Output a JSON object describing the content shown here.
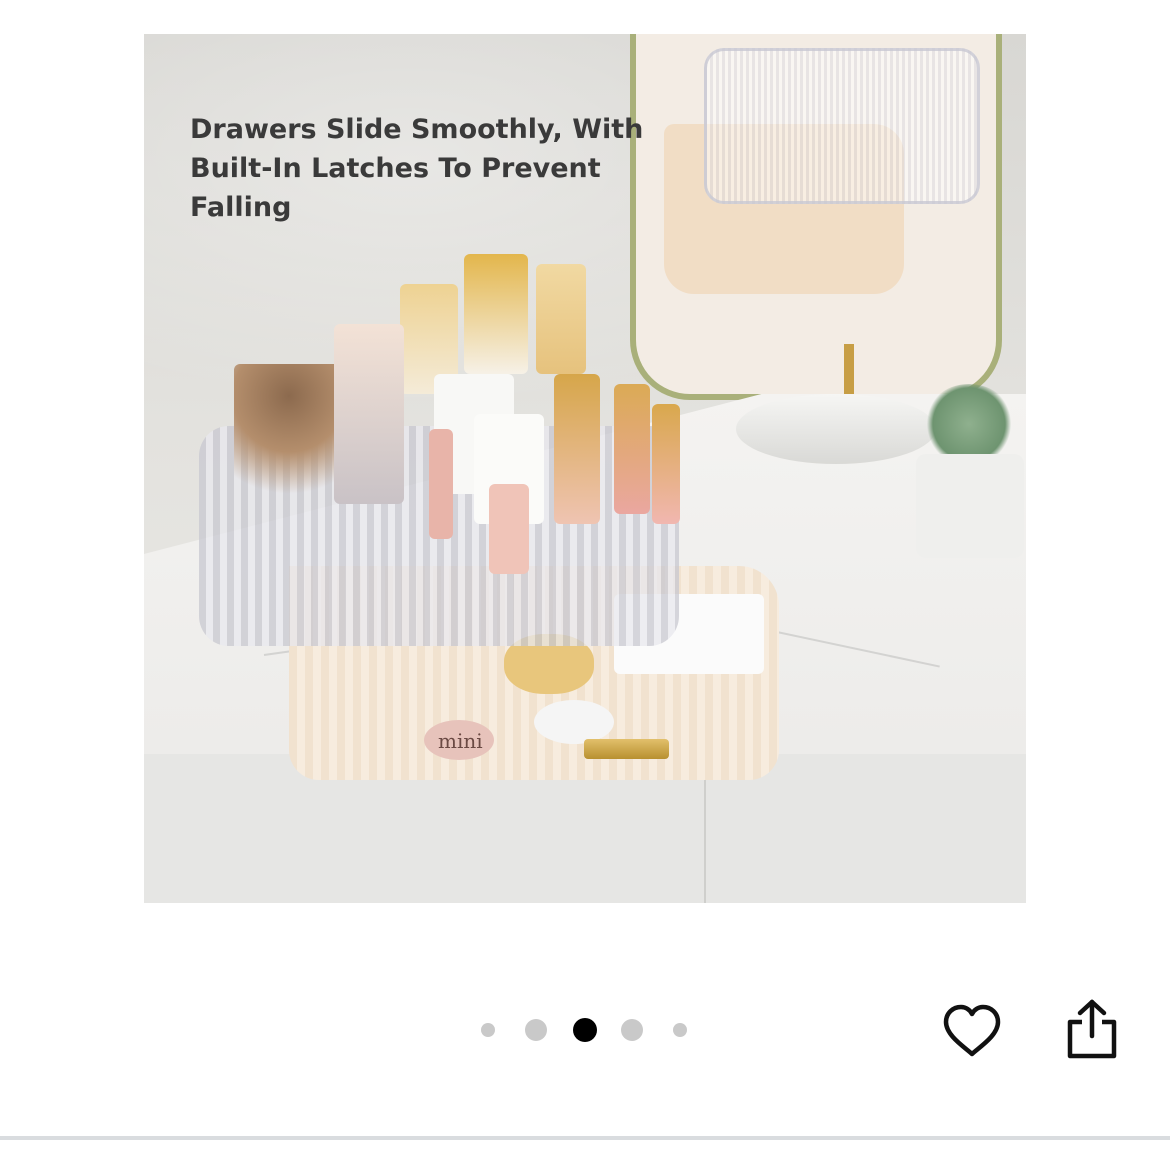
{
  "product_image": {
    "headline": "Drawers Slide Smoothly, With Built-In Latches To Prevent Falling",
    "jar_label": "mini"
  },
  "carousel": {
    "total": 5,
    "active_index": 2
  },
  "actions": {
    "favorite_icon": "heart-outline-icon",
    "share_icon": "share-icon"
  },
  "colors": {
    "active_dot": "#000000",
    "inactive_dot": "#c9c9c9",
    "icon": "#111111",
    "divider": "#d9dcdf"
  }
}
